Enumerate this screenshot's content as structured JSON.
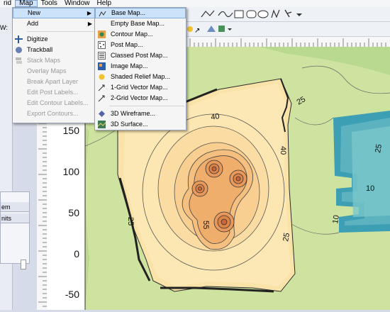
{
  "menubar": {
    "items": [
      {
        "label": "rid"
      },
      {
        "label": "Map"
      },
      {
        "label": "Tools"
      },
      {
        "label": "Window"
      },
      {
        "label": "Help"
      }
    ]
  },
  "left_panel": {
    "w_label": "W:",
    "tab_labels": [
      "em",
      "nits"
    ]
  },
  "map_menu": {
    "items": [
      {
        "label": "New",
        "submenu": true,
        "highlighted": true,
        "disabled": false
      },
      {
        "label": "Add",
        "submenu": true,
        "disabled": false
      },
      {
        "separator": true
      },
      {
        "label": "Digitize",
        "icon": "digitize-icon",
        "disabled": false
      },
      {
        "label": "Trackball",
        "icon": "trackball-icon",
        "disabled": false
      },
      {
        "label": "Stack Maps",
        "icon": "stack-maps-icon",
        "disabled": true
      },
      {
        "label": "Overlay Maps",
        "disabled": true
      },
      {
        "label": "Break Apart Layer",
        "disabled": true
      },
      {
        "label": "Edit Post Labels...",
        "disabled": true
      },
      {
        "label": "Edit Contour Labels...",
        "disabled": true
      },
      {
        "label": "Export Contours...",
        "disabled": true
      }
    ]
  },
  "new_submenu": {
    "items": [
      {
        "label": "Base Map...",
        "icon": "base-map-icon",
        "highlighted": true
      },
      {
        "label": "Empty Base Map...",
        "icon": ""
      },
      {
        "label": "Contour Map...",
        "icon": "contour-map-icon"
      },
      {
        "label": "Post Map...",
        "icon": "post-map-icon"
      },
      {
        "label": "Classed Post Map...",
        "icon": "classed-post-map-icon"
      },
      {
        "label": "Image Map...",
        "icon": "image-map-icon"
      },
      {
        "label": "Shaded Relief Map...",
        "icon": "shaded-relief-icon"
      },
      {
        "label": "1-Grid Vector Map...",
        "icon": "vector-1-icon"
      },
      {
        "label": "2-Grid Vector Map...",
        "icon": "vector-2-icon"
      },
      {
        "separator": true
      },
      {
        "label": "3D Wireframe...",
        "icon": "wireframe-icon"
      },
      {
        "label": "3D Surface...",
        "icon": "surface-icon"
      }
    ]
  },
  "plot": {
    "y_tick_labels": [
      "150",
      "100",
      "50",
      "0",
      "-50"
    ],
    "contour_labels": [
      "40",
      "25",
      "40",
      "25",
      "55",
      "10",
      "25",
      "10",
      "25"
    ]
  },
  "colors": {
    "plateau": "#fde6ad",
    "outer": "#cfe09a",
    "green_mid": "#a6d28a",
    "peak": "#e28a4f",
    "blue": "#4aa3b8",
    "accent": "#cbe2fb"
  }
}
